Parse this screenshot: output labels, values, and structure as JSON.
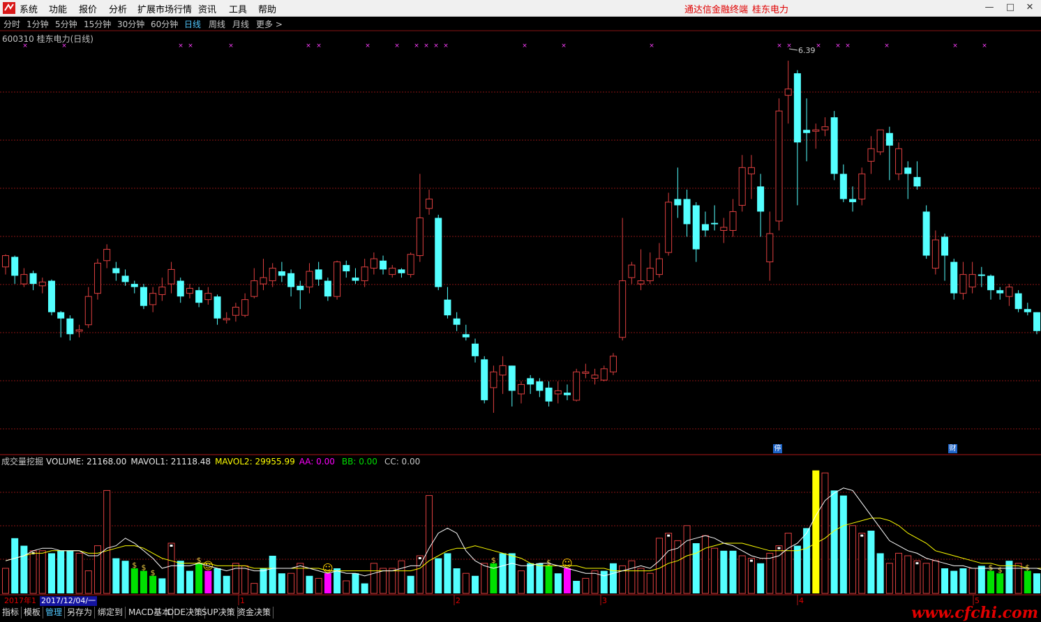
{
  "menu": [
    "系统",
    "功能",
    "报价",
    "分析",
    "扩展市场行情",
    "资讯",
    "工具",
    "帮助"
  ],
  "brand": {
    "terminal": "通达信金融终端",
    "stock": "桂东电力"
  },
  "periods": [
    "分时",
    "1分钟",
    "5分钟",
    "15分钟",
    "30分钟",
    "60分钟",
    "日线",
    "周线",
    "月线",
    "更多 >"
  ],
  "active_period": "日线",
  "stock_title": "600310 桂东电力(日线)",
  "high_label": "6.39",
  "badges": {
    "stop": "停",
    "finance": "财"
  },
  "indicator": {
    "name": "成交量挖掘",
    "volume": "VOLUME: 21168.00",
    "mavol1": "MAVOL1: 21118.48",
    "mavol2": "MAVOL2: 29955.99",
    "aa": "AA: 0.00",
    "bb": "BB: 0.00",
    "cc": "CC: 0.00"
  },
  "xaxis": {
    "year": "2017年1",
    "date": "2017/12/04/一",
    "ticks": [
      "1",
      "2",
      "3",
      "4",
      "5"
    ]
  },
  "bottom_tabs": [
    "指标",
    "模板",
    "管理",
    "另存为",
    "绑定到",
    "MACD基本",
    "DDE决策",
    "SUP决策",
    "资金决策"
  ],
  "active_tab": "管理",
  "watermark": "www.cfchi.com",
  "colors": {
    "up": "#e04040",
    "down": "#54ffff",
    "grid": "#8a1414",
    "ma1": "#ffffff",
    "ma2": "#ffff00",
    "signal_green": "#00e000",
    "signal_magenta": "#ff00ff",
    "signal_yellow": "#ffff00"
  },
  "chart_data": {
    "type": "candlestick",
    "candles": [
      {
        "o": 0.72,
        "c": 0.9,
        "h": 0.92,
        "l": 0.6
      },
      {
        "o": 0.88,
        "c": 0.58,
        "h": 0.9,
        "l": 0.45
      },
      {
        "o": 0.45,
        "c": 0.6,
        "h": 0.7,
        "l": 0.4
      },
      {
        "o": 0.62,
        "c": 0.45,
        "h": 0.66,
        "l": 0.35
      },
      {
        "o": 0.42,
        "c": 0.48,
        "h": 0.55,
        "l": 0.3
      },
      {
        "o": 0.5,
        "c": 0.0,
        "h": 0.52,
        "l": -0.05
      },
      {
        "o": 0.0,
        "c": -0.1,
        "h": 0.02,
        "l": -0.4
      },
      {
        "o": -0.1,
        "c": -0.35,
        "h": -0.05,
        "l": -0.45
      },
      {
        "o": -0.3,
        "c": -0.28,
        "h": -0.2,
        "l": -0.4
      },
      {
        "o": -0.2,
        "c": 0.25,
        "h": 0.4,
        "l": -0.25
      },
      {
        "o": 0.3,
        "c": 0.78,
        "h": 0.85,
        "l": 0.2
      },
      {
        "o": 0.82,
        "c": 1.0,
        "h": 1.08,
        "l": 0.7
      },
      {
        "o": 0.7,
        "c": 0.62,
        "h": 0.8,
        "l": 0.5
      },
      {
        "o": 0.58,
        "c": 0.48,
        "h": 0.68,
        "l": 0.42
      },
      {
        "o": 0.45,
        "c": 0.4,
        "h": 0.5,
        "l": 0.3
      },
      {
        "o": 0.4,
        "c": 0.1,
        "h": 0.45,
        "l": 0.05
      },
      {
        "o": 0.12,
        "c": 0.3,
        "h": 0.4,
        "l": 0.0
      },
      {
        "o": 0.28,
        "c": 0.4,
        "h": 0.55,
        "l": 0.18
      },
      {
        "o": 0.45,
        "c": 0.68,
        "h": 0.8,
        "l": 0.3
      },
      {
        "o": 0.5,
        "c": 0.25,
        "h": 0.55,
        "l": 0.15
      },
      {
        "o": 0.3,
        "c": 0.38,
        "h": 0.45,
        "l": 0.22
      },
      {
        "o": 0.35,
        "c": 0.15,
        "h": 0.4,
        "l": 0.08
      },
      {
        "o": 0.2,
        "c": 0.3,
        "h": 0.4,
        "l": 0.12
      },
      {
        "o": 0.25,
        "c": -0.1,
        "h": 0.28,
        "l": -0.2
      },
      {
        "o": -0.12,
        "c": -0.1,
        "h": 0.0,
        "l": -0.18
      },
      {
        "o": -0.05,
        "c": 0.08,
        "h": 0.15,
        "l": -0.15
      },
      {
        "o": -0.05,
        "c": 0.2,
        "h": 0.3,
        "l": -0.08
      },
      {
        "o": 0.25,
        "c": 0.5,
        "h": 0.7,
        "l": 0.22
      },
      {
        "o": 0.45,
        "c": 0.55,
        "h": 0.85,
        "l": 0.35
      },
      {
        "o": 0.5,
        "c": 0.7,
        "h": 0.78,
        "l": 0.4
      },
      {
        "o": 0.65,
        "c": 0.58,
        "h": 0.8,
        "l": 0.48
      },
      {
        "o": 0.62,
        "c": 0.4,
        "h": 0.68,
        "l": 0.25
      },
      {
        "o": 0.42,
        "c": 0.35,
        "h": 0.5,
        "l": 0.05
      },
      {
        "o": 0.4,
        "c": 0.65,
        "h": 0.78,
        "l": 0.3
      },
      {
        "o": 0.68,
        "c": 0.52,
        "h": 0.8,
        "l": 0.42
      },
      {
        "o": 0.5,
        "c": 0.25,
        "h": 0.55,
        "l": 0.18
      },
      {
        "o": 0.25,
        "c": 0.8,
        "h": 0.82,
        "l": 0.2
      },
      {
        "o": 0.75,
        "c": 0.65,
        "h": 0.82,
        "l": 0.55
      },
      {
        "o": 0.55,
        "c": 0.5,
        "h": 0.7,
        "l": 0.45
      },
      {
        "o": 0.5,
        "c": 0.72,
        "h": 0.85,
        "l": 0.4
      },
      {
        "o": 0.7,
        "c": 0.85,
        "h": 0.95,
        "l": 0.6
      },
      {
        "o": 0.82,
        "c": 0.68,
        "h": 0.9,
        "l": 0.6
      },
      {
        "o": 0.6,
        "c": 0.7,
        "h": 0.75,
        "l": 0.55
      },
      {
        "o": 0.68,
        "c": 0.62,
        "h": 0.7,
        "l": 0.55
      },
      {
        "o": 0.6,
        "c": 0.92,
        "h": 0.95,
        "l": 0.55
      },
      {
        "o": 0.9,
        "c": 1.5,
        "h": 2.2,
        "l": 0.8
      },
      {
        "o": 1.65,
        "c": 1.8,
        "h": 1.95,
        "l": 1.55
      },
      {
        "o": 1.5,
        "c": 0.4,
        "h": 1.55,
        "l": 0.35
      },
      {
        "o": 0.2,
        "c": -0.05,
        "h": 0.4,
        "l": -0.1
      },
      {
        "o": -0.1,
        "c": -0.2,
        "h": 0.0,
        "l": -0.3
      },
      {
        "o": -0.35,
        "c": -0.4,
        "h": -0.2,
        "l": -0.45
      },
      {
        "o": -0.5,
        "c": -0.7,
        "h": -0.42,
        "l": -0.8
      },
      {
        "o": -0.75,
        "c": -1.4,
        "h": -0.7,
        "l": -1.45
      },
      {
        "o": -1.2,
        "c": -0.95,
        "h": -0.85,
        "l": -1.6
      },
      {
        "o": -1.0,
        "c": -0.85,
        "h": -0.7,
        "l": -1.3
      },
      {
        "o": -0.85,
        "c": -1.25,
        "h": -0.85,
        "l": -1.5
      },
      {
        "o": -1.3,
        "c": -1.15,
        "h": -1.1,
        "l": -1.45
      },
      {
        "o": -1.05,
        "c": -1.15,
        "h": -1.0,
        "l": -1.3
      },
      {
        "o": -1.1,
        "c": -1.25,
        "h": -1.05,
        "l": -1.35
      },
      {
        "o": -1.2,
        "c": -1.42,
        "h": -1.1,
        "l": -1.5
      },
      {
        "o": -1.3,
        "c": -1.25,
        "h": -1.1,
        "l": -1.45
      },
      {
        "o": -1.28,
        "c": -1.32,
        "h": -1.15,
        "l": -1.4
      },
      {
        "o": -1.4,
        "c": -0.95,
        "h": -0.9,
        "l": -1.42
      },
      {
        "o": -0.95,
        "c": -0.95,
        "h": -0.82,
        "l": -1.05
      },
      {
        "o": -1.05,
        "c": -1.0,
        "h": -0.9,
        "l": -1.15
      },
      {
        "o": -1.08,
        "c": -0.9,
        "h": -0.85,
        "l": -1.1
      },
      {
        "o": -0.95,
        "c": -0.7,
        "h": -0.65,
        "l": -1.0
      },
      {
        "o": -0.4,
        "c": 0.5,
        "h": 1.5,
        "l": -0.45
      },
      {
        "o": 0.55,
        "c": 0.75,
        "h": 0.8,
        "l": 0.45
      },
      {
        "o": 0.45,
        "c": 0.5,
        "h": 1.0,
        "l": 0.35
      },
      {
        "o": 0.5,
        "c": 0.7,
        "h": 0.95,
        "l": 0.45
      },
      {
        "o": 0.6,
        "c": 0.85,
        "h": 1.1,
        "l": 0.55
      },
      {
        "o": 0.95,
        "c": 1.75,
        "h": 1.9,
        "l": 0.9
      },
      {
        "o": 1.8,
        "c": 1.7,
        "h": 2.3,
        "l": 1.5
      },
      {
        "o": 1.8,
        "c": 1.4,
        "h": 1.95,
        "l": 1.2
      },
      {
        "o": 1.7,
        "c": 1.0,
        "h": 1.75,
        "l": 0.8
      },
      {
        "o": 1.4,
        "c": 1.3,
        "h": 1.6,
        "l": 1.2
      },
      {
        "o": 1.42,
        "c": 1.4,
        "h": 1.7,
        "l": 1.3
      },
      {
        "o": 1.3,
        "c": 1.35,
        "h": 1.5,
        "l": 1.1
      },
      {
        "o": 1.3,
        "c": 1.6,
        "h": 1.8,
        "l": 1.2
      },
      {
        "o": 1.7,
        "c": 2.3,
        "h": 2.5,
        "l": 1.6
      },
      {
        "o": 2.2,
        "c": 2.3,
        "h": 2.5,
        "l": 1.8
      },
      {
        "o": 2.0,
        "c": 1.6,
        "h": 2.2,
        "l": 1.2
      },
      {
        "o": 0.8,
        "c": 1.25,
        "h": 1.6,
        "l": 0.5
      },
      {
        "o": 1.45,
        "c": 3.2,
        "h": 3.4,
        "l": 1.3
      },
      {
        "o": 3.45,
        "c": 3.55,
        "h": 4.0,
        "l": 3.0
      },
      {
        "o": 3.8,
        "c": 2.7,
        "h": 3.85,
        "l": 1.7
      },
      {
        "o": 2.9,
        "c": 2.85,
        "h": 3.4,
        "l": 2.4
      },
      {
        "o": 2.9,
        "c": 2.9,
        "h": 3.0,
        "l": 2.6
      },
      {
        "o": 2.9,
        "c": 2.95,
        "h": 3.1,
        "l": 2.8
      },
      {
        "o": 3.1,
        "c": 2.2,
        "h": 3.2,
        "l": 2.1
      },
      {
        "o": 2.2,
        "c": 1.8,
        "h": 2.35,
        "l": 1.75
      },
      {
        "o": 1.8,
        "c": 1.75,
        "h": 2.0,
        "l": 1.6
      },
      {
        "o": 1.8,
        "c": 2.2,
        "h": 2.3,
        "l": 1.7
      },
      {
        "o": 2.4,
        "c": 2.6,
        "h": 2.8,
        "l": 2.2
      },
      {
        "o": 2.55,
        "c": 2.9,
        "h": 2.9,
        "l": 2.5
      },
      {
        "o": 2.85,
        "c": 2.65,
        "h": 2.95,
        "l": 2.1
      },
      {
        "o": 2.2,
        "c": 2.6,
        "h": 2.7,
        "l": 2.1
      },
      {
        "o": 2.3,
        "c": 2.2,
        "h": 2.4,
        "l": 1.8
      },
      {
        "o": 2.15,
        "c": 2.0,
        "h": 2.4,
        "l": 1.95
      },
      {
        "o": 1.6,
        "c": 0.9,
        "h": 1.7,
        "l": 0.85
      },
      {
        "o": 0.7,
        "c": 1.15,
        "h": 1.3,
        "l": 0.6
      },
      {
        "o": 1.2,
        "c": 0.9,
        "h": 1.25,
        "l": 0.5
      },
      {
        "o": 0.8,
        "c": 0.3,
        "h": 0.85,
        "l": 0.2
      },
      {
        "o": 0.3,
        "c": 0.6,
        "h": 0.8,
        "l": 0.2
      },
      {
        "o": 0.4,
        "c": 0.6,
        "h": 0.8,
        "l": 0.3
      },
      {
        "o": 0.6,
        "c": 0.58,
        "h": 0.72,
        "l": 0.4
      },
      {
        "o": 0.58,
        "c": 0.35,
        "h": 0.6,
        "l": 0.2
      },
      {
        "o": 0.35,
        "c": 0.3,
        "h": 0.4,
        "l": 0.2
      },
      {
        "o": 0.25,
        "c": 0.4,
        "h": 0.45,
        "l": 0.1
      },
      {
        "o": 0.3,
        "c": 0.05,
        "h": 0.35,
        "l": 0.0
      },
      {
        "o": 0.05,
        "c": 0.0,
        "h": 0.15,
        "l": -0.05
      },
      {
        "o": 0.0,
        "c": -0.3,
        "h": 0.0,
        "l": -0.35
      }
    ],
    "volumes": [
      10,
      22,
      19,
      17,
      17,
      16,
      17,
      17,
      16,
      9,
      19,
      41,
      14,
      13,
      10,
      9,
      7,
      6,
      20,
      13,
      9,
      12,
      9,
      10,
      7,
      12,
      11,
      4,
      10,
      15,
      8,
      8,
      12,
      7,
      6,
      8,
      10,
      5,
      8,
      4,
      12,
      10,
      10,
      13,
      7,
      15,
      39,
      14,
      16,
      10,
      8,
      7,
      12,
      12,
      16,
      16,
      9,
      12,
      12,
      11,
      8,
      10,
      5,
      6,
      9,
      9,
      12,
      11,
      13,
      10,
      8,
      22,
      24,
      21,
      27,
      20,
      23,
      18,
      17,
      17,
      15,
      14,
      12,
      16,
      19,
      24,
      19,
      26,
      49,
      48,
      41,
      39,
      27,
      24,
      25,
      16,
      12,
      16,
      15,
      13,
      12,
      13,
      10,
      9,
      10,
      10,
      11,
      9,
      8,
      13,
      12,
      9,
      8,
      8,
      10,
      7,
      8,
      7,
      8,
      7,
      7,
      8,
      7
    ],
    "volume_colors": [
      "r",
      "c",
      "c",
      "r",
      "r",
      "c",
      "c",
      "c",
      "r",
      "r",
      "r",
      "r",
      "c",
      "c",
      "g",
      "g",
      "g",
      "c",
      "r",
      "c",
      "c",
      "g",
      "m",
      "c",
      "c",
      "r",
      "r",
      "r",
      "c",
      "c",
      "c",
      "r",
      "r",
      "c",
      "r",
      "m",
      "c",
      "r",
      "c",
      "c",
      "r",
      "r",
      "r",
      "r",
      "c",
      "r",
      "r",
      "c",
      "c",
      "c",
      "r",
      "c",
      "r",
      "g",
      "c",
      "c",
      "r",
      "c",
      "c",
      "g",
      "c",
      "m",
      "c",
      "r",
      "r",
      "c",
      "c",
      "r",
      "r",
      "r",
      "r",
      "r",
      "r",
      "r",
      "r",
      "c",
      "r",
      "r",
      "c",
      "c",
      "r",
      "r",
      "c",
      "r",
      "r",
      "r",
      "c",
      "c",
      "y",
      "r",
      "c",
      "c",
      "r",
      "r",
      "c",
      "c",
      "r",
      "r",
      "r",
      "r",
      "r",
      "r",
      "c",
      "c",
      "c",
      "r",
      "c",
      "g",
      "g",
      "c",
      "r",
      "g",
      "c",
      "r",
      "g",
      "r",
      "c",
      "c",
      "r",
      "c",
      "r",
      "r",
      "c"
    ],
    "ma5": [
      13,
      14,
      15,
      17,
      18,
      18,
      17,
      17,
      17,
      15,
      15,
      18,
      19,
      22,
      20,
      17,
      14,
      10,
      11,
      11,
      11,
      12,
      11,
      10,
      9,
      10,
      10,
      9,
      9,
      10,
      10,
      10,
      11,
      10,
      9,
      8,
      9,
      8,
      8,
      7,
      8,
      9,
      9,
      10,
      11,
      11,
      18,
      24,
      26,
      24,
      17,
      13,
      11,
      10,
      11,
      12,
      11,
      11,
      12,
      12,
      11,
      10,
      9,
      8,
      8,
      7,
      8,
      9,
      10,
      11,
      10,
      13,
      17,
      18,
      21,
      22,
      23,
      22,
      20,
      19,
      17,
      15,
      14,
      14,
      15,
      18,
      20,
      24,
      31,
      37,
      40,
      42,
      41,
      36,
      31,
      26,
      21,
      19,
      17,
      16,
      14,
      13,
      12,
      11,
      11,
      10,
      10,
      10,
      10,
      10,
      10,
      10,
      10,
      9,
      9,
      8,
      8,
      8,
      8,
      8,
      8,
      7,
      8
    ],
    "ma10": [
      13,
      14,
      15,
      16,
      16,
      17,
      17,
      17,
      17,
      16,
      16,
      17,
      18,
      19,
      19,
      18,
      16,
      14,
      13,
      12,
      12,
      12,
      12,
      11,
      11,
      11,
      11,
      10,
      10,
      10,
      10,
      10,
      10,
      10,
      10,
      9,
      9,
      9,
      9,
      9,
      9,
      9,
      9,
      9,
      9,
      10,
      13,
      15,
      17,
      18,
      18,
      19,
      18,
      17,
      16,
      15,
      14,
      12,
      11,
      11,
      11,
      11,
      11,
      10,
      10,
      10,
      9,
      9,
      9,
      9,
      9,
      10,
      12,
      13,
      15,
      16,
      18,
      19,
      20,
      20,
      20,
      19,
      18,
      17,
      17,
      17,
      17,
      18,
      20,
      22,
      25,
      27,
      28,
      29,
      30,
      30,
      29,
      27,
      24,
      22,
      20,
      17,
      16,
      15,
      14,
      13,
      12,
      12,
      11,
      11,
      11,
      10,
      10,
      10,
      10,
      9,
      9,
      9,
      9,
      8,
      8,
      8,
      8
    ]
  }
}
